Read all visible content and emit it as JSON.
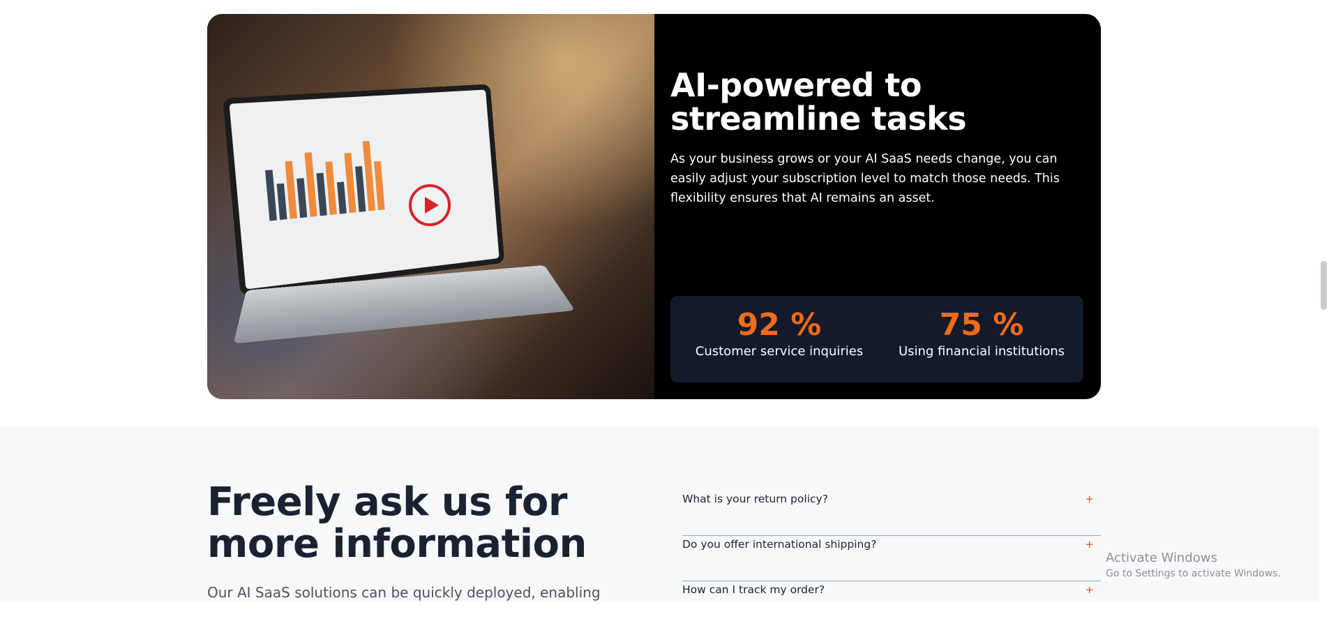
{
  "feature": {
    "title_line1": "AI-powered to",
    "title_line2": "streamline tasks",
    "description": "As your business grows or your AI SaaS needs change, you can easily adjust your subscription level to match those needs. This flexibility ensures that AI remains an asset.",
    "stats": [
      {
        "value": "92 %",
        "label": "Customer service inquiries"
      },
      {
        "value": "75 %",
        "label": "Using financial institutions"
      }
    ]
  },
  "faq": {
    "heading_line1": "Freely ask us for",
    "heading_line2": "more information",
    "intro": "Our AI SaaS solutions can be quickly deployed, enabling",
    "items": [
      {
        "question": "What is your return policy?",
        "icon": "+"
      },
      {
        "question": "Do you offer international shipping?",
        "icon": "+"
      },
      {
        "question": "How can I track my order?",
        "icon": "+"
      }
    ]
  },
  "watermark": {
    "title": "Activate Windows",
    "subtitle": "Go to Settings to activate Windows."
  },
  "colors": {
    "accent": "#f26a1b",
    "stats_bg": "#131a2b",
    "heading": "#1a2232"
  }
}
